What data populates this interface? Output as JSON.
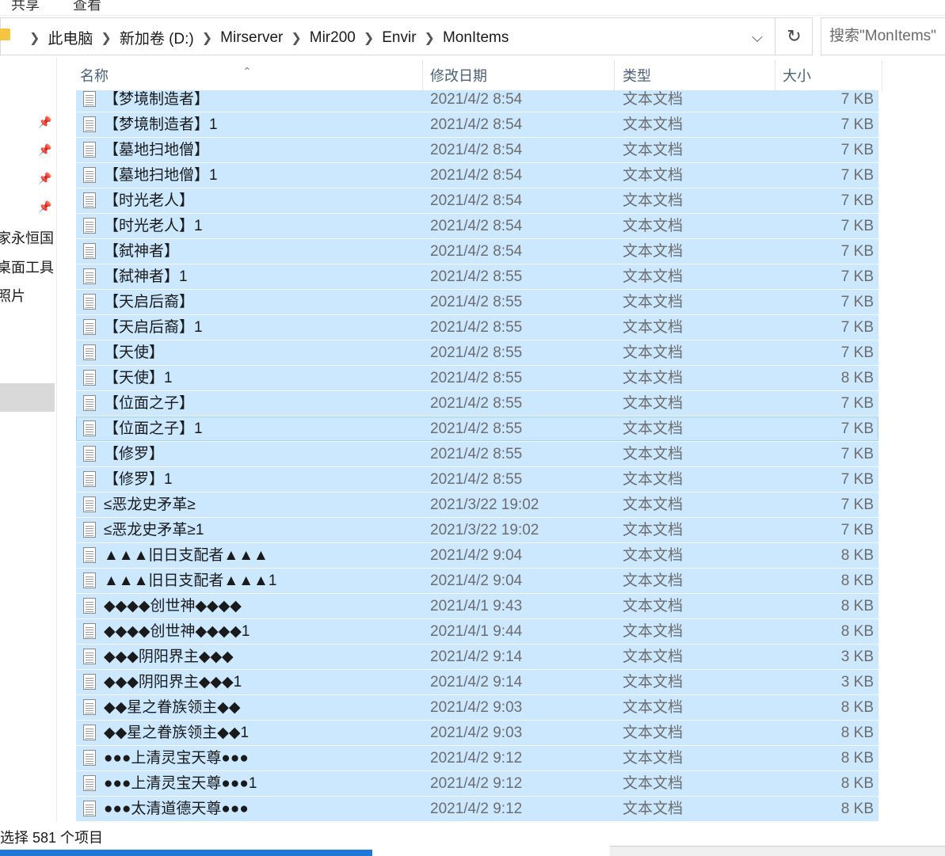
{
  "ribbon": {
    "tabs": [
      "共享",
      "查看"
    ]
  },
  "address": {
    "crumbs": [
      "此电脑",
      "新加卷 (D:)",
      "Mirserver",
      "Mir200",
      "Envir",
      "MonItems"
    ]
  },
  "search": {
    "placeholder": "搜索\"MonItems\""
  },
  "nav": {
    "items": [
      "家永恒国良",
      "桌面工具",
      "照片"
    ]
  },
  "columns": {
    "name": "名称",
    "date": "修改日期",
    "type": "类型",
    "size": "大小"
  },
  "files": [
    {
      "name": "【梦境制造者】",
      "date": "2021/4/2 8:54",
      "type": "文本文档",
      "size": "7 KB"
    },
    {
      "name": "【梦境制造者】1",
      "date": "2021/4/2 8:54",
      "type": "文本文档",
      "size": "7 KB"
    },
    {
      "name": "【墓地扫地僧】",
      "date": "2021/4/2 8:54",
      "type": "文本文档",
      "size": "7 KB"
    },
    {
      "name": "【墓地扫地僧】1",
      "date": "2021/4/2 8:54",
      "type": "文本文档",
      "size": "7 KB"
    },
    {
      "name": "【时光老人】",
      "date": "2021/4/2 8:54",
      "type": "文本文档",
      "size": "7 KB"
    },
    {
      "name": "【时光老人】1",
      "date": "2021/4/2 8:54",
      "type": "文本文档",
      "size": "7 KB"
    },
    {
      "name": "【弑神者】",
      "date": "2021/4/2 8:54",
      "type": "文本文档",
      "size": "7 KB"
    },
    {
      "name": "【弑神者】1",
      "date": "2021/4/2 8:55",
      "type": "文本文档",
      "size": "7 KB"
    },
    {
      "name": "【天启后裔】",
      "date": "2021/4/2 8:55",
      "type": "文本文档",
      "size": "7 KB"
    },
    {
      "name": "【天启后裔】1",
      "date": "2021/4/2 8:55",
      "type": "文本文档",
      "size": "7 KB"
    },
    {
      "name": "【天使】",
      "date": "2021/4/2 8:55",
      "type": "文本文档",
      "size": "7 KB"
    },
    {
      "name": "【天使】1",
      "date": "2021/4/2 8:55",
      "type": "文本文档",
      "size": "8 KB"
    },
    {
      "name": "【位面之子】",
      "date": "2021/4/2 8:55",
      "type": "文本文档",
      "size": "7 KB"
    },
    {
      "name": "【位面之子】1",
      "date": "2021/4/2 8:55",
      "type": "文本文档",
      "size": "7 KB"
    },
    {
      "name": "【修罗】",
      "date": "2021/4/2 8:55",
      "type": "文本文档",
      "size": "7 KB"
    },
    {
      "name": "【修罗】1",
      "date": "2021/4/2 8:55",
      "type": "文本文档",
      "size": "7 KB"
    },
    {
      "name": "≤恶龙史矛革≥",
      "date": "2021/3/22 19:02",
      "type": "文本文档",
      "size": "7 KB"
    },
    {
      "name": "≤恶龙史矛革≥1",
      "date": "2021/3/22 19:02",
      "type": "文本文档",
      "size": "7 KB"
    },
    {
      "name": "▲▲▲旧日支配者▲▲▲",
      "date": "2021/4/2 9:04",
      "type": "文本文档",
      "size": "8 KB"
    },
    {
      "name": "▲▲▲旧日支配者▲▲▲1",
      "date": "2021/4/2 9:04",
      "type": "文本文档",
      "size": "8 KB"
    },
    {
      "name": "◆◆◆◆创世神◆◆◆◆",
      "date": "2021/4/1 9:43",
      "type": "文本文档",
      "size": "8 KB"
    },
    {
      "name": "◆◆◆◆创世神◆◆◆◆1",
      "date": "2021/4/1 9:44",
      "type": "文本文档",
      "size": "8 KB"
    },
    {
      "name": "◆◆◆阴阳界主◆◆◆",
      "date": "2021/4/2 9:14",
      "type": "文本文档",
      "size": "3 KB"
    },
    {
      "name": "◆◆◆阴阳界主◆◆◆1",
      "date": "2021/4/2 9:14",
      "type": "文本文档",
      "size": "3 KB"
    },
    {
      "name": "◆◆星之眷族领主◆◆",
      "date": "2021/4/2 9:03",
      "type": "文本文档",
      "size": "8 KB"
    },
    {
      "name": "◆◆星之眷族领主◆◆1",
      "date": "2021/4/2 9:03",
      "type": "文本文档",
      "size": "8 KB"
    },
    {
      "name": "●●●上清灵宝天尊●●●",
      "date": "2021/4/2 9:12",
      "type": "文本文档",
      "size": "8 KB"
    },
    {
      "name": "●●●上清灵宝天尊●●●1",
      "date": "2021/4/2 9:12",
      "type": "文本文档",
      "size": "8 KB"
    },
    {
      "name": "●●●太清道德天尊●●●",
      "date": "2021/4/2 9:12",
      "type": "文本文档",
      "size": "8 KB"
    }
  ],
  "status": {
    "text": "选择 581 个项目"
  }
}
